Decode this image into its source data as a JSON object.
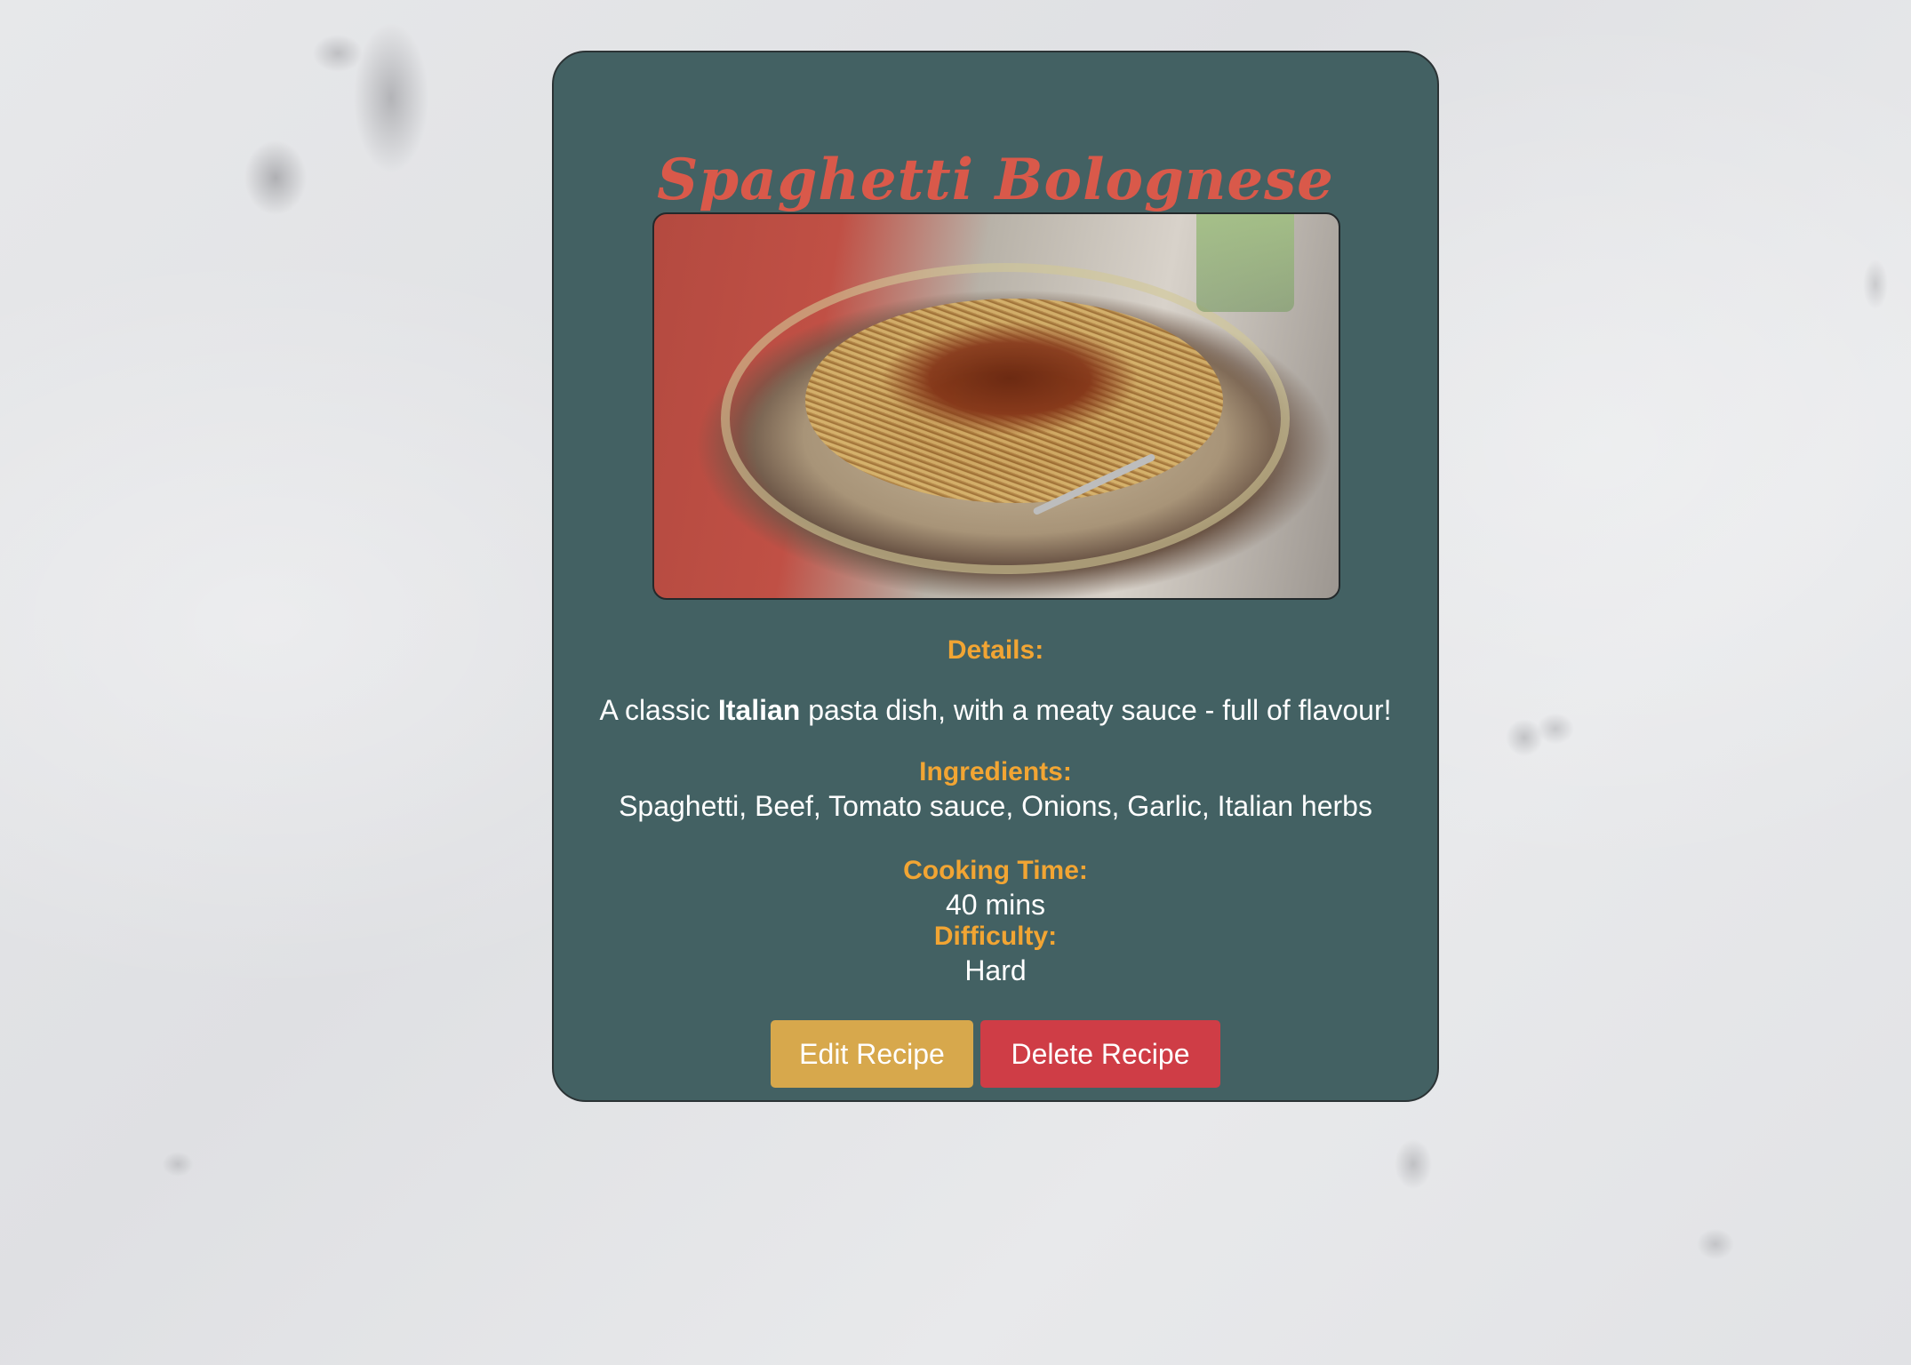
{
  "recipe": {
    "title": "Spaghetti Bolognese",
    "image_alt": "Spaghetti Bolognese",
    "details_label": "Details:",
    "description_prefix": "A classic ",
    "description_bold": "Italian",
    "description_suffix": " pasta dish, with a meaty sauce - full of flavour!",
    "ingredients_label": "Ingredients:",
    "ingredients": "Spaghetti, Beef, Tomato sauce, Onions, Garlic, Italian herbs",
    "cooking_time_label": "Cooking Time:",
    "cooking_time": "40 mins",
    "difficulty_label": "Difficulty:",
    "difficulty": "Hard"
  },
  "actions": {
    "edit_label": "Edit Recipe",
    "delete_label": "Delete Recipe"
  },
  "colors": {
    "card_bg": "#436163",
    "title": "#d9594a",
    "label": "#f2a533",
    "edit_button": "#d7a84c",
    "delete_button": "#cf3d46"
  }
}
